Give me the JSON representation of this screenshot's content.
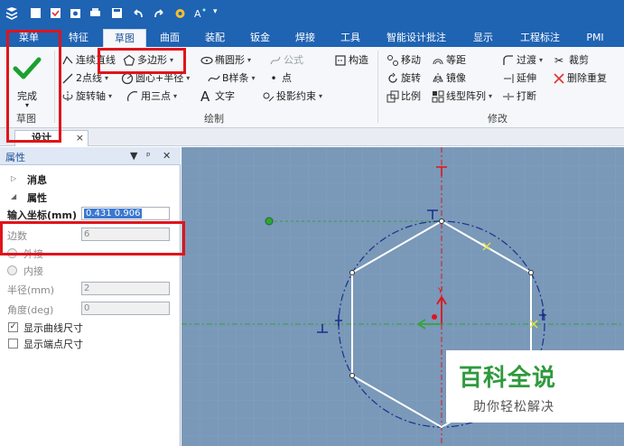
{
  "tabs": [
    "菜单",
    "特征",
    "草图",
    "曲面",
    "装配",
    "钣金",
    "焊接",
    "工具",
    "智能设计批注",
    "显示",
    "工程标注",
    "PMI"
  ],
  "active_tab": "草图",
  "ribbon": {
    "done": "完成",
    "group_sketch": "草图",
    "draw": {
      "r1": [
        "连续直线",
        "多边形",
        "椭圆形",
        "公式",
        "构造"
      ],
      "r2": [
        "2点线",
        "圆心+半径",
        "B样条",
        "点"
      ],
      "r3": [
        "旋转轴",
        "用三点",
        "文字",
        "投影约束"
      ],
      "label": "绘制"
    },
    "modify": {
      "r1": [
        "移动",
        "等距",
        "过渡",
        "裁剪"
      ],
      "r2": [
        "旋转",
        "镜像",
        "延伸",
        "删除重复"
      ],
      "r3": [
        "比例",
        "线型阵列",
        "打断"
      ],
      "label": "修改"
    }
  },
  "doc_tab": {
    "label": "设计",
    "close": "×"
  },
  "panel": {
    "title": "属性",
    "tools": [
      "▼",
      "ᵖ",
      "✕"
    ],
    "sections": [
      "消息",
      "属性"
    ],
    "coord_label": "输入坐标(mm)",
    "coord_value": "0.431 0.906",
    "sides_label": "边数",
    "sides_value": "6",
    "outer_label": "外接",
    "inner_label": "内接",
    "radius_label": "半径(mm)",
    "radius_value": "2",
    "angle_label": "角度(deg)",
    "angle_value": "0",
    "check_curve": "显示曲线尺寸",
    "check_end": "显示端点尺寸"
  },
  "watermark": {
    "title": "百科全说",
    "sub": "助你轻松解决"
  },
  "colors": {
    "accent": "#1f63b3",
    "highlight": "#e0141b",
    "canvas": "#7a98b8",
    "check_green": "#1aa12e"
  }
}
